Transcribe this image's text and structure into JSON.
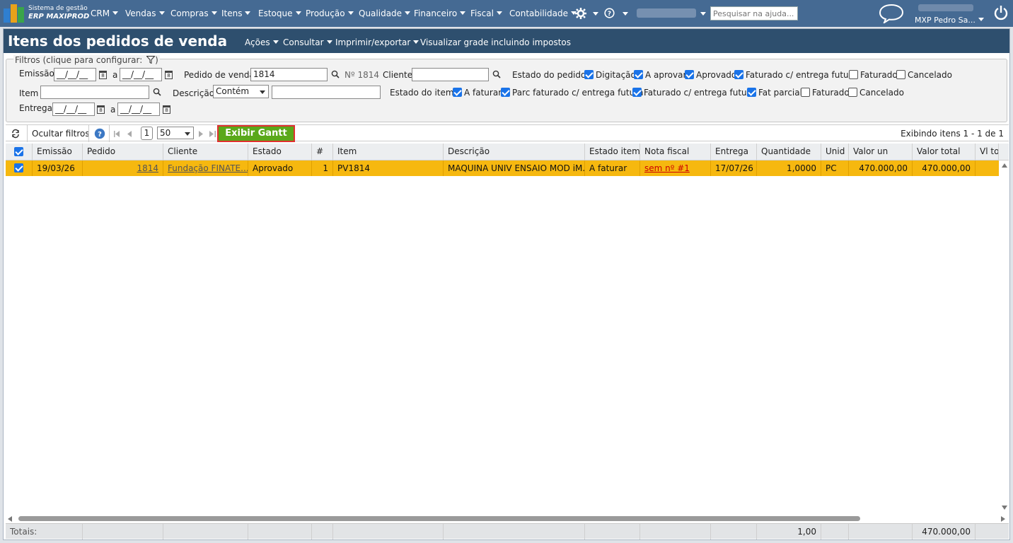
{
  "app": {
    "brand_line1": "Sistema de gestão",
    "brand_line2": "ERP MAXIPROD",
    "search_placeholder": "Pesquisar na ajuda...",
    "user": "MXP Pedro Sa...",
    "menu": [
      "CRM",
      "Vendas",
      "Compras",
      "Itens",
      "Estoque",
      "Produção",
      "Qualidade",
      "Financeiro",
      "Fiscal",
      "Contabilidade"
    ]
  },
  "page": {
    "title": "Itens dos pedidos de venda",
    "actions": "Ações",
    "consult": "Consultar",
    "print": "Imprimir/exportar",
    "grid_taxes": "Visualizar grade incluindo impostos"
  },
  "filters": {
    "legend": "Filtros (clique para configurar:",
    "legend_close": ")",
    "emissao": "Emissão",
    "a": "a",
    "date_mask": "__/__/__",
    "pedido_label": "Pedido de venda",
    "pedido_value": "1814",
    "pedido_no": "Nº 1814",
    "cliente_label": "Cliente",
    "estado_pedido_label": "Estado do pedido",
    "estado_pedido": [
      {
        "label": "Digitação",
        "checked": true
      },
      {
        "label": "A aprovar",
        "checked": true
      },
      {
        "label": "Aprovado",
        "checked": true
      },
      {
        "label": "Faturado c/ entrega futura",
        "checked": true
      },
      {
        "label": "Faturado",
        "checked": false
      },
      {
        "label": "Cancelado",
        "checked": false
      }
    ],
    "item_label": "Item",
    "descricao_label": "Descrição",
    "descricao_mode": "Contém",
    "estado_item_label": "Estado do item",
    "estado_item": [
      {
        "label": "A faturar",
        "checked": true
      },
      {
        "label": "Parc faturado c/ entrega futura",
        "checked": true
      },
      {
        "label": "Faturado c/ entrega futura",
        "checked": true
      },
      {
        "label": "Fat parcial",
        "checked": true
      },
      {
        "label": "Faturado",
        "checked": false
      },
      {
        "label": "Cancelado",
        "checked": false
      }
    ],
    "entrega_label": "Entrega"
  },
  "toolbar": {
    "hide_filters": "Ocultar filtros",
    "page": "1",
    "page_size": "50",
    "gantt": "Exibir Gantt",
    "showing": "Exibindo itens 1 - 1 de 1"
  },
  "grid": {
    "columns": [
      "Emissão",
      "Pedido",
      "Cliente",
      "Estado",
      "#",
      "Item",
      "Descrição",
      "Estado item",
      "Nota fiscal",
      "Entrega",
      "Quantidade",
      "Unid",
      "Valor un",
      "Valor total",
      "Vl to"
    ],
    "row": {
      "emissao": "19/03/26",
      "pedido": "1814",
      "cliente": "Fundação FINATE...",
      "estado": "Aprovado",
      "num": "1",
      "item": "PV1814",
      "descricao": "MAQUINA UNIV ENSAIO MOD iM...",
      "estado_item": "A faturar",
      "nota": "sem nº #1",
      "entrega": "17/07/26",
      "quantidade": "1,0000",
      "unid": "PC",
      "valor_un": "470.000,00",
      "valor_total": "470.000,00"
    },
    "totals_label": "Totais:",
    "total_qty": "1,00",
    "total_value": "470.000,00"
  }
}
